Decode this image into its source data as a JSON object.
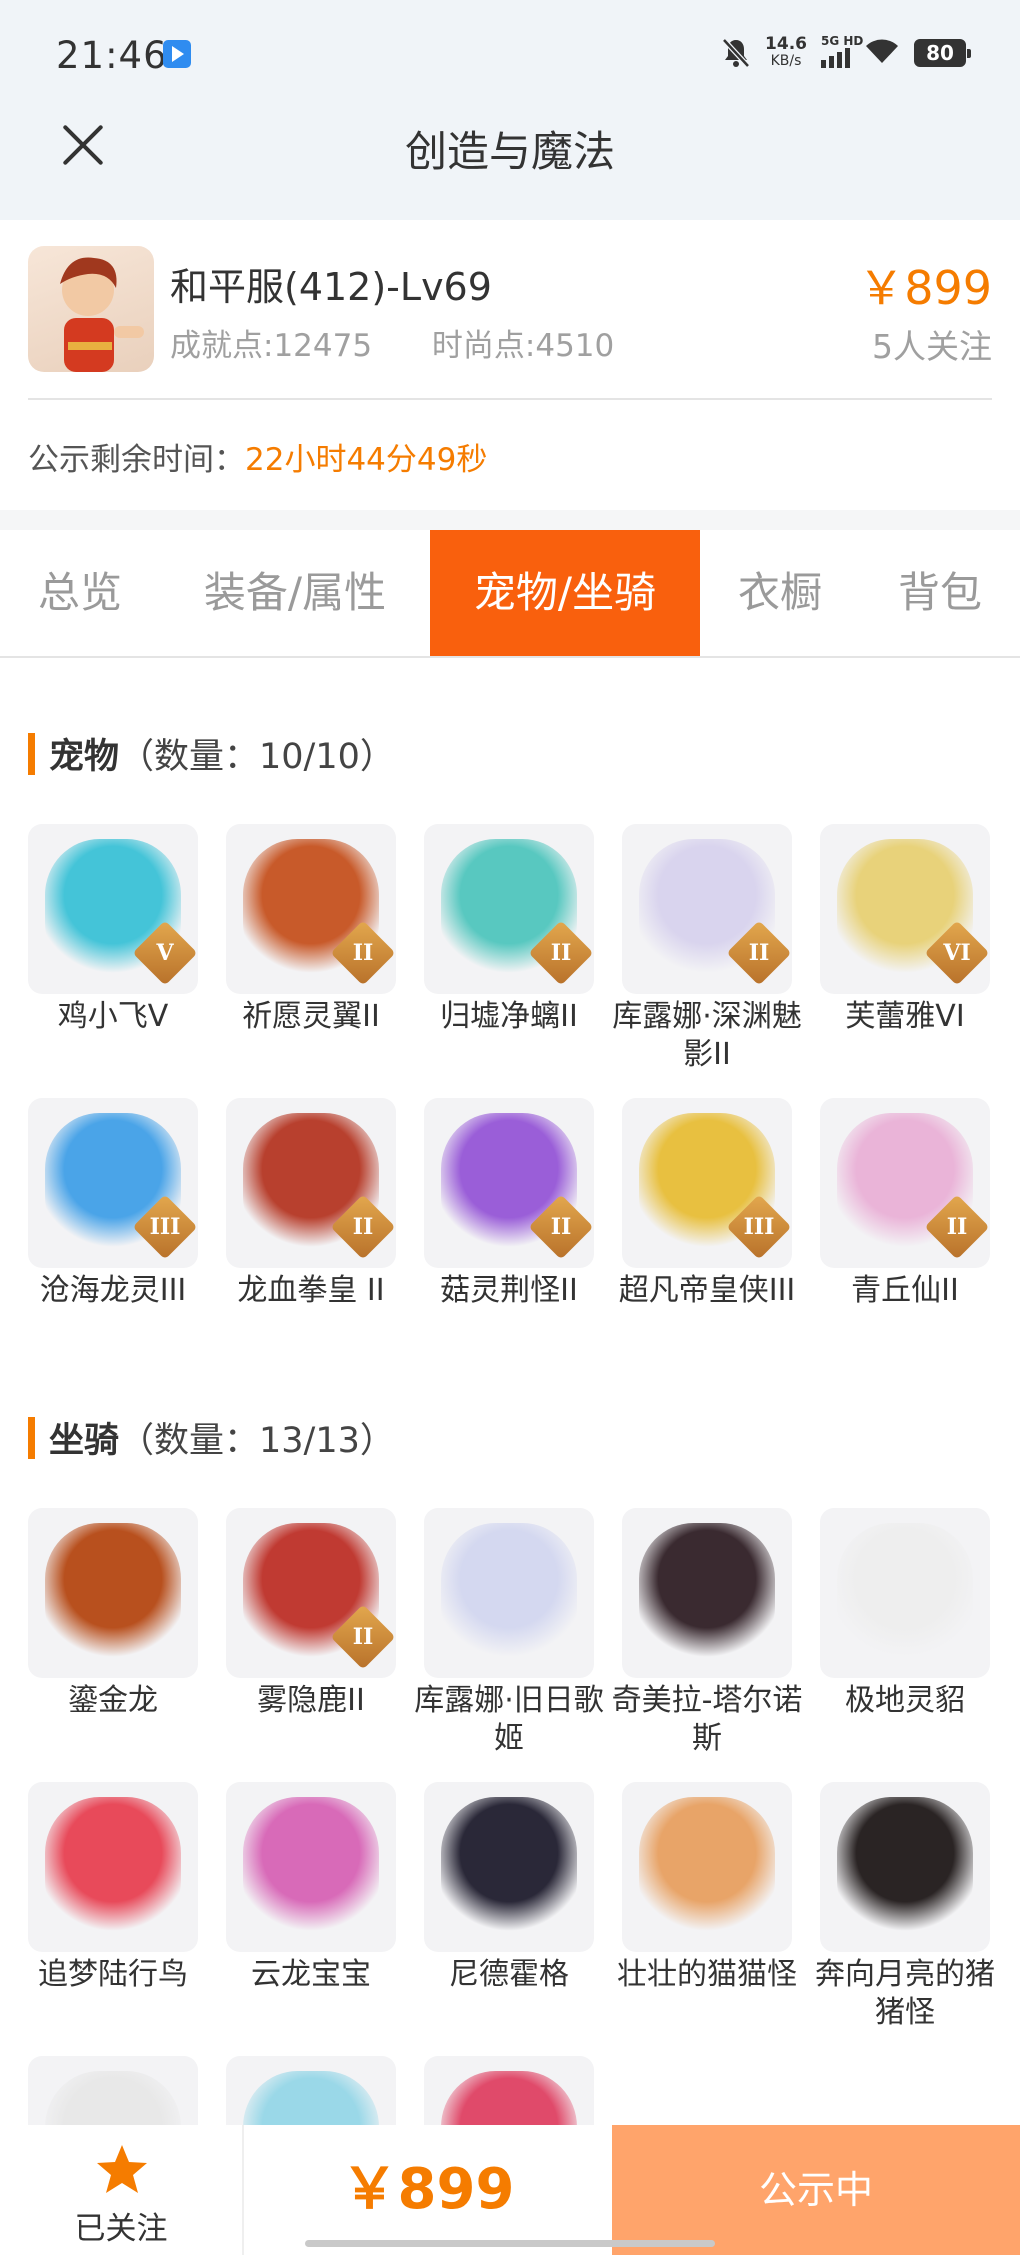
{
  "status_bar": {
    "time": "21:46",
    "net_speed_value": "14.6",
    "net_speed_unit": "KB/s",
    "network": "5G HD",
    "battery": "80"
  },
  "nav": {
    "title": "创造与魔法"
  },
  "product": {
    "server": "和平服(412)-Lv69",
    "achievement": "成就点:12475",
    "fashion": "时尚点:4510",
    "price": "￥899",
    "followers": "5人关注",
    "countdown_label": "公示剩余时间：",
    "countdown_value": "22小时44分49秒"
  },
  "tabs": [
    {
      "label": "总览"
    },
    {
      "label": "装备/属性"
    },
    {
      "label": "宠物/坐骑",
      "active": true
    },
    {
      "label": "衣橱"
    },
    {
      "label": "背包"
    }
  ],
  "pets": {
    "title": "宠物",
    "count": "（数量：10/10）",
    "items": [
      {
        "name": "鸡小飞V",
        "tier": "V",
        "icon": "chick-pet",
        "color": "#44c4d8"
      },
      {
        "name": "祈愿灵翼II",
        "tier": "II",
        "icon": "griffin-pet",
        "color": "#c85a2a"
      },
      {
        "name": "归墟净螭II",
        "tier": "II",
        "icon": "dragon-pet",
        "color": "#58c8c0"
      },
      {
        "name": "库露娜·深渊魅影II",
        "tier": "II",
        "icon": "girl-pet",
        "color": "#d9d4ee"
      },
      {
        "name": "芙蕾雅VI",
        "tier": "VI",
        "icon": "valkyrie-pet",
        "color": "#e8d27a"
      },
      {
        "name": "沧海龙灵III",
        "tier": "III",
        "icon": "sea-dragon-pet",
        "color": "#4aa4e8"
      },
      {
        "name": "龙血拳皇 II",
        "tier": "II",
        "icon": "dragon-fist-pet",
        "color": "#b8402e"
      },
      {
        "name": "菇灵荆怪II",
        "tier": "II",
        "icon": "mushroom-pet",
        "color": "#9a5ed8"
      },
      {
        "name": "超凡帝皇侠III",
        "tier": "III",
        "icon": "armored-pet",
        "color": "#e8c040"
      },
      {
        "name": "青丘仙II",
        "tier": "II",
        "icon": "fox-fairy-pet",
        "color": "#eab4d8"
      }
    ]
  },
  "mounts": {
    "title": "坐骑",
    "count": "（数量：13/13）",
    "items": [
      {
        "name": "鎏金龙",
        "tier": "",
        "icon": "golden-dragon-mount",
        "color": "#b8501e"
      },
      {
        "name": "雾隐鹿II",
        "tier": "II",
        "icon": "deer-mount",
        "color": "#c03a32"
      },
      {
        "name": "库露娜·旧日歌姬",
        "tier": "",
        "icon": "singer-mount",
        "color": "#d4d8f0"
      },
      {
        "name": "奇美拉-塔尔诺斯",
        "tier": "",
        "icon": "chimera-mount",
        "color": "#3a2a30"
      },
      {
        "name": "极地灵貂",
        "tier": "",
        "icon": "marten-mount",
        "color": "#eeeeee"
      },
      {
        "name": "追梦陆行鸟",
        "tier": "",
        "icon": "bird-mount",
        "color": "#e84a5a"
      },
      {
        "name": "云龙宝宝",
        "tier": "",
        "icon": "cloud-dragon-mount",
        "color": "#d86ab8"
      },
      {
        "name": "尼德霍格",
        "tier": "",
        "icon": "nidhogg-mount",
        "color": "#2a2838"
      },
      {
        "name": "壮壮的猫猫怪",
        "tier": "",
        "icon": "cat-mount",
        "color": "#e8a468"
      },
      {
        "name": "奔向月亮的猪猪怪",
        "tier": "",
        "icon": "pig-mount",
        "color": "#2a2424"
      },
      {
        "name": "",
        "tier": "",
        "icon": "partial-mount-1",
        "color": "#e8e8e8"
      },
      {
        "name": "",
        "tier": "",
        "icon": "partial-mount-2",
        "color": "#9ad8e8"
      },
      {
        "name": "",
        "tier": "",
        "icon": "partial-mount-3",
        "color": "#e04a6a"
      }
    ]
  },
  "bottom": {
    "follow_label": "已关注",
    "price": "￥899",
    "status_label": "公示中"
  }
}
